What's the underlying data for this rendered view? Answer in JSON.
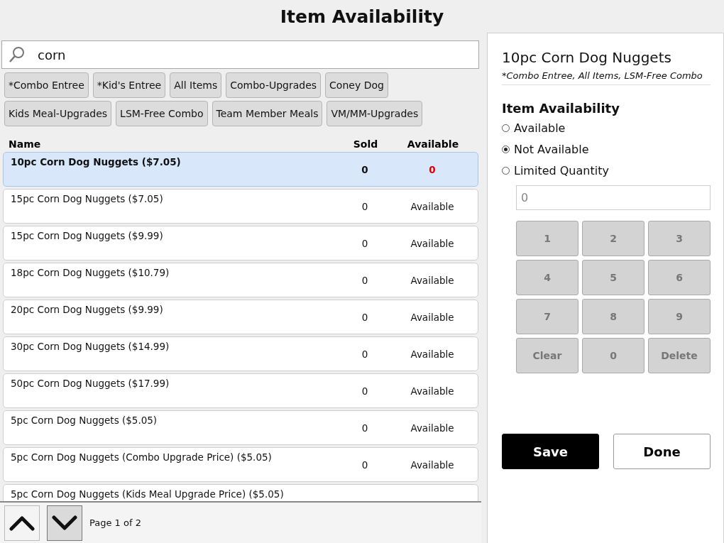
{
  "title": "Item Availability",
  "search": {
    "value": "corn"
  },
  "categories": [
    {
      "label": "*Combo Entree"
    },
    {
      "label": "*Kid's Entree"
    },
    {
      "label": "All Items"
    },
    {
      "label": "Combo-Upgrades"
    },
    {
      "label": "Coney Dog"
    },
    {
      "label": "Kids Meal-Upgrades"
    },
    {
      "label": "LSM-Free Combo"
    },
    {
      "label": "Team Member Meals"
    },
    {
      "label": "VM/MM-Upgrades"
    }
  ],
  "table": {
    "columns": [
      "Name",
      "Sold",
      "Available"
    ],
    "rows": [
      {
        "name": "10pc Corn Dog Nuggets ($7.05)",
        "sold": "0",
        "available": "0",
        "selected": true
      },
      {
        "name": "15pc Corn Dog Nuggets ($7.05)",
        "sold": "0",
        "available": "Available",
        "selected": false
      },
      {
        "name": "15pc Corn Dog Nuggets ($9.99)",
        "sold": "0",
        "available": "Available",
        "selected": false
      },
      {
        "name": "18pc Corn Dog Nuggets ($10.79)",
        "sold": "0",
        "available": "Available",
        "selected": false
      },
      {
        "name": "20pc Corn Dog Nuggets ($9.99)",
        "sold": "0",
        "available": "Available",
        "selected": false
      },
      {
        "name": "30pc Corn Dog Nuggets ($14.99)",
        "sold": "0",
        "available": "Available",
        "selected": false
      },
      {
        "name": "50pc Corn Dog Nuggets ($17.99)",
        "sold": "0",
        "available": "Available",
        "selected": false
      },
      {
        "name": "5pc Corn Dog Nuggets ($5.05)",
        "sold": "0",
        "available": "Available",
        "selected": false
      },
      {
        "name": "5pc Corn Dog Nuggets (Combo Upgrade Price) ($5.05)",
        "sold": "0",
        "available": "Available",
        "selected": false
      },
      {
        "name": "5pc Corn Dog Nuggets (Kids Meal Upgrade Price) ($5.05)",
        "sold": "",
        "available": "",
        "selected": false
      }
    ]
  },
  "pager": {
    "text": "Page 1 of 2",
    "up_pressed": false,
    "down_pressed": true
  },
  "detail": {
    "title": "10pc Corn Dog Nuggets",
    "categories": "*Combo Entree, All Items, LSM-Free Combo",
    "section": "Item Availability",
    "options": [
      {
        "label": "Available",
        "selected": false
      },
      {
        "label": "Not Available",
        "selected": true
      },
      {
        "label": "Limited Quantity",
        "selected": false
      }
    ],
    "quantity": {
      "placeholder": "0"
    },
    "keypad": {
      "disabled": true,
      "keys": [
        "1",
        "2",
        "3",
        "4",
        "5",
        "6",
        "7",
        "8",
        "9",
        "Clear",
        "0",
        "Delete"
      ]
    },
    "buttons": [
      {
        "label": "Save",
        "kind": "primary"
      },
      {
        "label": "Done",
        "kind": "secondary"
      }
    ]
  }
}
